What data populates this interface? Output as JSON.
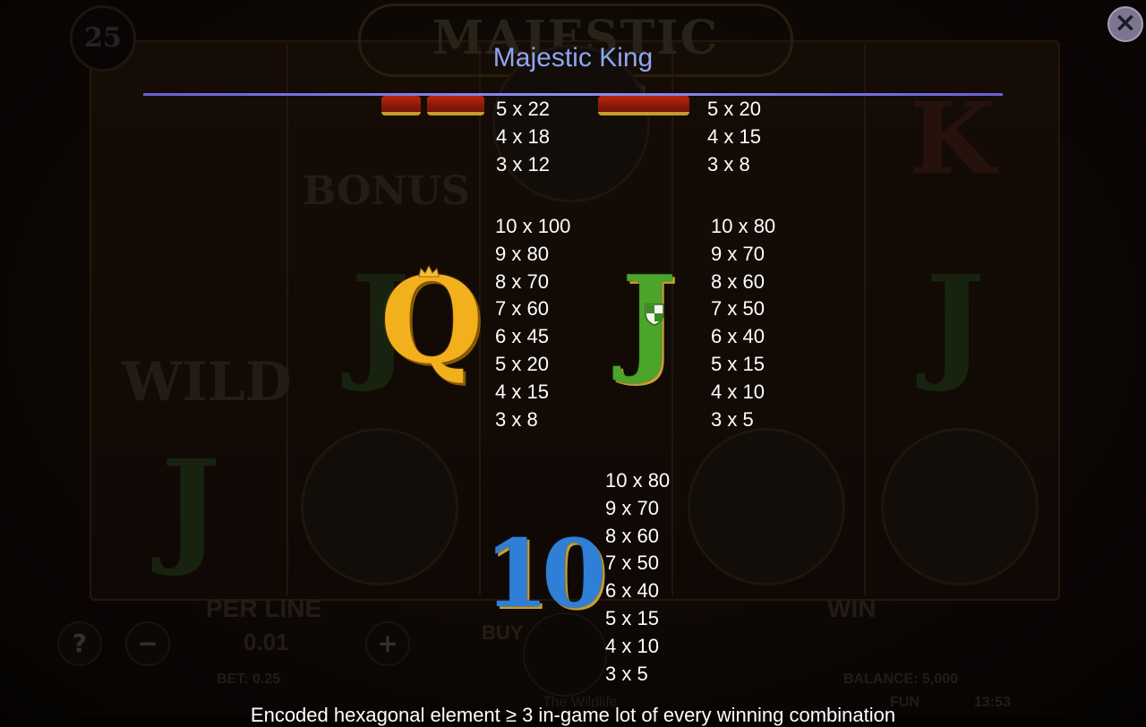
{
  "background": {
    "logo": "MAJESTIC KING",
    "lines_badge": "25",
    "per_line_label": "PER LINE",
    "per_line_value": "0.01",
    "win_label": "WIN",
    "buy_label": "BUY",
    "bet_label": "BET: 0.25",
    "balance_label": "BALANCE: 5,000",
    "game_name": "The Wildlife",
    "mode": "FUN",
    "clock": "13:53",
    "reel_labels": {
      "bonus": "BONUS",
      "wild": "WILD",
      "k": "K"
    }
  },
  "paytable": {
    "title": "Majestic King",
    "close_icon": "close-icon",
    "rows": {
      "top_left": [
        "5 x 22",
        "4 x 18",
        "3 x 12"
      ],
      "top_right": [
        "5 x 20",
        "4 x 15",
        "3 x 8"
      ],
      "q": [
        "10 x 100",
        "9 x 80",
        "8 x 70",
        "7 x 60",
        "6 x 45",
        "5 x 20",
        "4 x 15",
        "3 x 8"
      ],
      "j": [
        "10 x 80",
        "9 x 70",
        "8 x 60",
        "7 x 50",
        "6 x 40",
        "5 x 15",
        "4 x 10",
        "3 x 5"
      ],
      "ten": [
        "10 x 80",
        "9 x 70",
        "8 x 60",
        "7 x 50",
        "6 x 40",
        "5 x 15",
        "4 x 10",
        "3 x 5"
      ]
    },
    "symbols": {
      "q": "Q",
      "j": "J",
      "ten": "10"
    },
    "footer_text": "Encoded hexagonal element ≥ 3 in-game lot of every winning combination"
  },
  "colors": {
    "title": "#8ea5f0",
    "rule": "#7a7fe8",
    "text": "#ffffff",
    "q_gold": "#f2b01c",
    "j_green": "#4aa52a",
    "ten_blue": "#2f7fd6"
  }
}
